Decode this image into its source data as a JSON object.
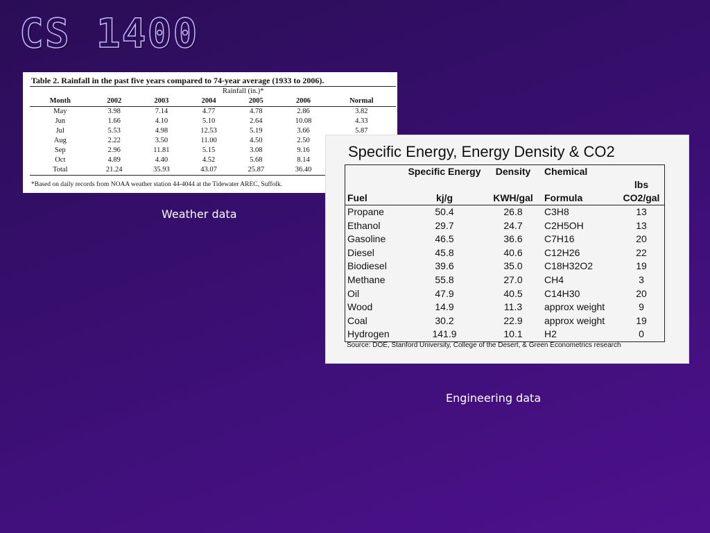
{
  "slide": {
    "title": "CS 1400",
    "weather_caption": "Weather data",
    "engineering_caption": "Engineering data"
  },
  "rainfall_table": {
    "caption": "Table 2. Rainfall in the past five years compared to 74-year average (1933 to 2006).",
    "super_header": "Rainfall (in.)*",
    "headers": [
      "Month",
      "2002",
      "2003",
      "2004",
      "2005",
      "2006",
      "Normal"
    ],
    "rows": [
      [
        "May",
        "3.98",
        "7.14",
        "4.77",
        "4.78",
        "2.86",
        "3.82"
      ],
      [
        "Jun",
        "1.66",
        "4.10",
        "5.10",
        "2.64",
        "10.08",
        "4.33"
      ],
      [
        "Jul",
        "5.53",
        "4.98",
        "12.53",
        "5.19",
        "3.66",
        "5.87"
      ],
      [
        "Aug",
        "2.22",
        "3.50",
        "11.00",
        "4.50",
        "2.50",
        ""
      ],
      [
        "Sep",
        "2.96",
        "11.81",
        "5.15",
        "3.08",
        "9.16",
        ""
      ],
      [
        "Oct",
        "4.89",
        "4.40",
        "4.52",
        "5.68",
        "8.14",
        ""
      ],
      [
        "Total",
        "21.24",
        "35.93",
        "43.07",
        "25.87",
        "36.40",
        ""
      ]
    ],
    "footnote": "*Based on daily records from NOAA weather station 44-4044 at the Tidewater AREC, Suffolk."
  },
  "energy_table": {
    "title": "Specific Energy, Energy Density & CO2",
    "header_top": [
      "",
      "Specific Energy",
      "Density",
      "Chemical",
      ""
    ],
    "header_bottom": [
      "Fuel",
      "kj/g",
      "KWH/gal",
      "Formula",
      "lbs CO2/gal"
    ],
    "rows": [
      [
        "Propane",
        "50.4",
        "26.8",
        "C3H8",
        "13"
      ],
      [
        "Ethanol",
        "29.7",
        "24.7",
        "C2H5OH",
        "13"
      ],
      [
        "Gasoline",
        "46.5",
        "36.6",
        "C7H16",
        "20"
      ],
      [
        "Diesel",
        "45.8",
        "40.6",
        "C12H26",
        "22"
      ],
      [
        "Biodiesel",
        "39.6",
        "35.0",
        "C18H32O2",
        "19"
      ],
      [
        "Methane",
        "55.8",
        "27.0",
        "CH4",
        "3"
      ],
      [
        "Oil",
        "47.9",
        "40.5",
        "C14H30",
        "20"
      ],
      [
        "Wood",
        "14.9",
        "11.3",
        "approx weight",
        "9"
      ],
      [
        "Coal",
        "30.2",
        "22.9",
        "approx weight",
        "19"
      ],
      [
        "Hydrogen",
        "141.9",
        "10.1",
        "H2",
        "0"
      ]
    ],
    "source": "Source: DOE, Stanford University, College of the Desert, & Green Econometrics research"
  }
}
